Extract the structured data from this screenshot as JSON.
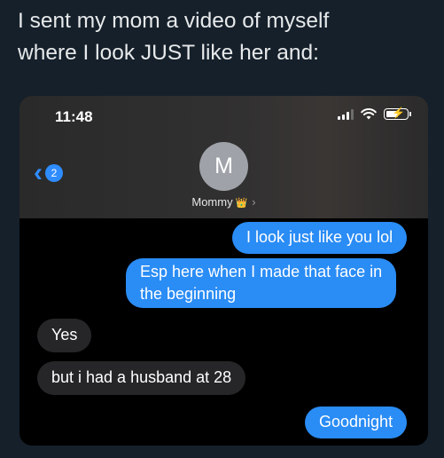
{
  "caption": {
    "line1": "I sent my mom a video of myself",
    "line2": "where I look JUST like her and:"
  },
  "status_bar": {
    "time": "11:48"
  },
  "header": {
    "unread_count": "2",
    "avatar_initial": "M",
    "contact_name": "Mommy",
    "crown": "👑",
    "chevron": "›"
  },
  "messages": [
    {
      "from": "me",
      "text": "I look just like you lol"
    },
    {
      "from": "me",
      "lines": [
        "Esp here when I made that face in",
        "the beginning"
      ]
    },
    {
      "from": "mom",
      "text": "Yes"
    },
    {
      "from": "mom",
      "text": "but i had a husband at 28"
    },
    {
      "from": "me",
      "text": "Goodnight"
    }
  ],
  "colors": {
    "sent_bubble": "#2a8cf5",
    "received_bubble": "#262628",
    "ios_blue": "#2f8cff",
    "page_bg": "#15202b"
  }
}
